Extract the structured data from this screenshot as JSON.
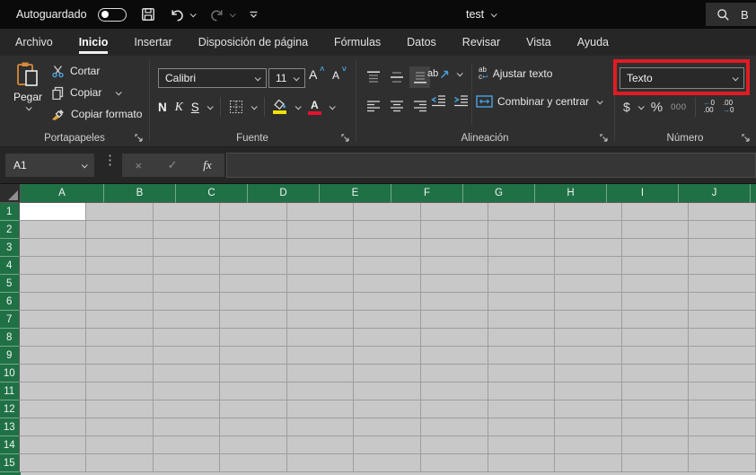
{
  "colors": {
    "header_green": "#1f7145",
    "annotation_red": "#e11b22",
    "accent_blue": "#4aa3df",
    "fill_yellow": "#f5e003",
    "font_color_red": "#e8112d",
    "cell_gray": "#c8c8c8",
    "ribbon_dark": "#2f2f2f",
    "titlebar_black": "#0a0a0a"
  },
  "titlebar": {
    "autosave_label": "Autoguardado",
    "autosave_state": "off",
    "document_title": "test",
    "search_label": "B"
  },
  "ribbon_tabs": [
    {
      "label": "Archivo",
      "active": false
    },
    {
      "label": "Inicio",
      "active": true
    },
    {
      "label": "Insertar",
      "active": false
    },
    {
      "label": "Disposición de página",
      "active": false
    },
    {
      "label": "Fórmulas",
      "active": false
    },
    {
      "label": "Datos",
      "active": false
    },
    {
      "label": "Revisar",
      "active": false
    },
    {
      "label": "Vista",
      "active": false
    },
    {
      "label": "Ayuda",
      "active": false
    }
  ],
  "clipboard": {
    "group_label": "Portapapeles",
    "paste_label": "Pegar",
    "cut_label": "Cortar",
    "copy_label": "Copiar",
    "format_painter_label": "Copiar formato"
  },
  "font": {
    "group_label": "Fuente",
    "font_name": "Calibri",
    "font_size": "11",
    "bold_label": "N",
    "italic_label": "K",
    "underline_label": "S",
    "grow_letter": "A",
    "shrink_letter": "A",
    "color_letter": "A"
  },
  "alignment": {
    "group_label": "Alineación",
    "orientation_text": "ab",
    "wrap_icon_top": "ab",
    "wrap_icon_bottom": "c",
    "wrap_text_label": "Ajustar texto",
    "merge_center_label": "Combinar y centrar"
  },
  "number": {
    "group_label": "Número",
    "format_value": "Texto",
    "currency_label": "$",
    "percent_label": "%",
    "thousands_label": "000",
    "inc_decimal_arrow": "←",
    "inc_decimal_top": "0",
    "inc_decimal_bottom": ".00",
    "dec_decimal_top": ".00",
    "dec_decimal_arrow": "→",
    "dec_decimal_bottom": "0"
  },
  "formula_bar": {
    "name_box_value": "A1",
    "fx_label": "fx",
    "cancel_glyph": "×",
    "enter_glyph": "✓"
  },
  "grid": {
    "columns": [
      "A",
      "B",
      "C",
      "D",
      "E",
      "F",
      "G",
      "H",
      "I",
      "J"
    ],
    "rows": [
      "1",
      "2",
      "3",
      "4",
      "5",
      "6",
      "7",
      "8",
      "9",
      "10",
      "11",
      "12",
      "13",
      "14",
      "15"
    ],
    "selected_cell": "A1"
  }
}
